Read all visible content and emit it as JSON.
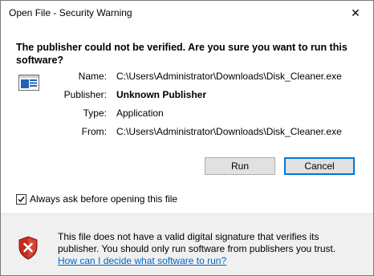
{
  "window": {
    "title": "Open File - Security Warning",
    "close_glyph": "✕"
  },
  "warning": {
    "headline": "The publisher could not be verified.  Are you sure you want to run this software?"
  },
  "details": {
    "name_label": "Name:",
    "name_value": "C:\\Users\\Administrator\\Downloads\\Disk_Cleaner.exe",
    "publisher_label": "Publisher:",
    "publisher_value": "Unknown Publisher",
    "type_label": "Type:",
    "type_value": "Application",
    "from_label": "From:",
    "from_value": "C:\\Users\\Administrator\\Downloads\\Disk_Cleaner.exe"
  },
  "buttons": {
    "run": "Run",
    "cancel": "Cancel"
  },
  "checkbox": {
    "label": "Always ask before opening this file",
    "checked": true
  },
  "footer": {
    "text": "This file does not have a valid digital signature that verifies its publisher.  You should only run software from publishers you trust.",
    "link": "How can I decide what software to run?"
  },
  "icons": {
    "file": "application-file-icon",
    "shield": "shield-error-icon"
  },
  "colors": {
    "link": "#0066cc",
    "shield_red": "#c42b1c",
    "default_button_border": "#0078d7"
  }
}
